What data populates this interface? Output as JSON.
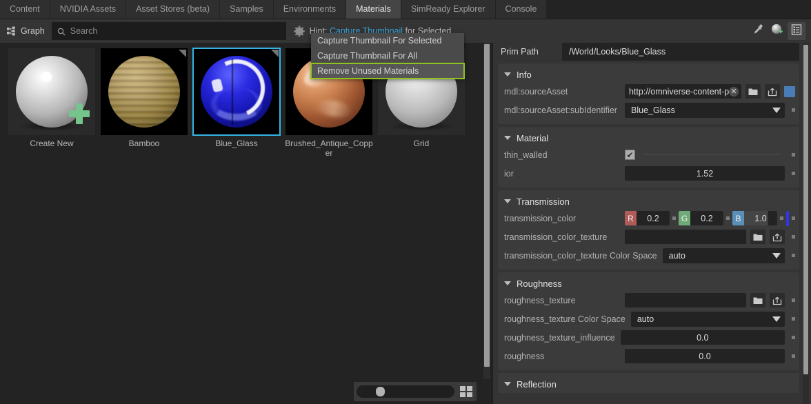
{
  "tabs": [
    {
      "label": "Content",
      "active": false
    },
    {
      "label": "NVIDIA Assets",
      "active": false
    },
    {
      "label": "Asset Stores (beta)",
      "active": false
    },
    {
      "label": "Samples",
      "active": false
    },
    {
      "label": "Environments",
      "active": false
    },
    {
      "label": "Materials",
      "active": true
    },
    {
      "label": "SimReady Explorer",
      "active": false
    },
    {
      "label": "Console",
      "active": false
    }
  ],
  "toolbar": {
    "graph_label": "Graph",
    "search_placeholder": "Search",
    "search_value": "",
    "hint_prefix": "Hint: ",
    "hint_link1": "Capture",
    "hint_mid": " ",
    "hint_link2": "Thumbnail",
    "hint_suffix": " for Selected",
    "icons": {
      "eyedropper": "eyedropper-icon",
      "add_material": "add-material-icon",
      "menu": "options-menu-icon"
    }
  },
  "context_menu": {
    "items": [
      {
        "label": "Capture Thumbnail For Selected",
        "highlighted": false
      },
      {
        "label": "Capture Thumbnail For All",
        "highlighted": false
      },
      {
        "label": "Remove Unused Materials",
        "highlighted": true
      }
    ],
    "highlight_color": "#8fc31f"
  },
  "browser": {
    "cards": [
      {
        "label": "Create New",
        "kind": "create",
        "selected": false
      },
      {
        "label": "Bamboo",
        "kind": "bamboo",
        "selected": false
      },
      {
        "label": "Blue_Glass",
        "kind": "glass",
        "selected": true
      },
      {
        "label": "Brushed_Antique_Copper",
        "kind": "copper",
        "selected": false
      },
      {
        "label": "Grid",
        "kind": "grid",
        "selected": false
      }
    ],
    "zoom_value": "",
    "grid_toggle": "grid-view-toggle"
  },
  "properties": {
    "prim_path_label": "Prim Path",
    "prim_path_value": "/World/Looks/Blue_Glass",
    "sections": [
      {
        "title": "Info",
        "rows": [
          {
            "name": "mdl:sourceAsset",
            "type": "asset",
            "value": "http://omniverse-content-p",
            "has_clear": true,
            "buttons": [
              "folder-icon",
              "external-link-icon"
            ],
            "swatch": "#4a7db5"
          },
          {
            "name": "mdl:sourceAsset:subIdentifier",
            "type": "combo",
            "value": "Blue_Glass"
          }
        ]
      },
      {
        "title": "Material",
        "rows": [
          {
            "name": "thin_walled",
            "type": "checkbox",
            "checked": true
          },
          {
            "name": "ior",
            "type": "number",
            "value": "1.52"
          }
        ]
      },
      {
        "title": "Transmission",
        "rows": [
          {
            "name": "transmission_color",
            "type": "color",
            "r": "0.2",
            "g": "0.2",
            "b": "1.0",
            "swatch": "#3333ee"
          },
          {
            "name": "transmission_color_texture",
            "type": "texture",
            "value": "",
            "buttons": [
              "folder-icon",
              "external-link-icon"
            ]
          },
          {
            "name": "transmission_color_texture Color Space",
            "type": "combo",
            "value": "auto"
          }
        ]
      },
      {
        "title": "Roughness",
        "rows": [
          {
            "name": "roughness_texture",
            "type": "texture",
            "value": "",
            "buttons": [
              "folder-icon",
              "external-link-icon"
            ]
          },
          {
            "name": "roughness_texture Color Space",
            "type": "combo",
            "value": "auto"
          },
          {
            "name": "roughness_texture_influence",
            "type": "number",
            "value": "0.0"
          },
          {
            "name": "roughness",
            "type": "number",
            "value": "0.0"
          }
        ]
      },
      {
        "title": "Reflection",
        "rows": []
      }
    ]
  }
}
